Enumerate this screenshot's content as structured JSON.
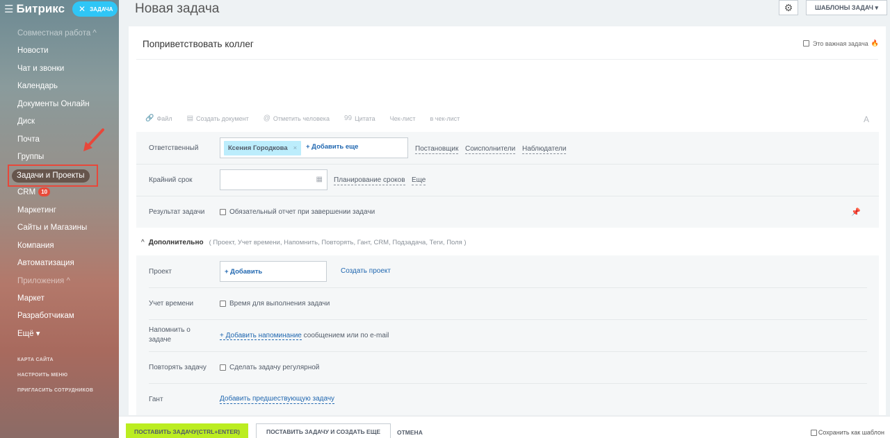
{
  "sidebar": {
    "logo": "Битрикс",
    "task_pill": "ЗАДАЧА",
    "section_collab": "Совместная работа ^",
    "items": [
      "Новости",
      "Чат и звонки",
      "Календарь",
      "Документы Онлайн",
      "Диск",
      "Почта",
      "Группы"
    ],
    "active_item": "Задачи и Проекты",
    "crm_label": "CRM",
    "crm_badge": "10",
    "items2": [
      "Маркетинг",
      "Сайты и Магазины",
      "Компания",
      "Автоматизация"
    ],
    "section_apps": "Приложения ^",
    "items3": [
      "Маркет",
      "Разработчикам",
      "Ещё ▾"
    ],
    "footer_links": [
      "КАРТА САЙТА",
      "НАСТРОИТЬ МЕНЮ",
      "ПРИГЛАСИТЬ СОТРУДНИКОВ"
    ]
  },
  "header": {
    "title": "Новая задача",
    "templates_button": "ШАБЛОНЫ ЗАДАЧ ▾"
  },
  "form": {
    "task_title": "Поприветствовать коллег",
    "important_label": "Это важная задача",
    "toolbar": [
      "Файл",
      "Создать документ",
      "Отметить человека",
      "Цитата",
      "Чек-лист",
      "в чек-лист"
    ],
    "font_icon": "A",
    "responsible": {
      "label": "Ответственный",
      "chip": "Ксения Городкова",
      "add_more": "+ Добавить еще",
      "links": [
        "Постановщик",
        "Соисполнители",
        "Наблюдатели"
      ]
    },
    "deadline": {
      "label": "Крайний срок",
      "link_planning": "Планирование сроков",
      "link_more": "Еще"
    },
    "result": {
      "label": "Результат задачи",
      "checkbox": "Обязательный отчет при завершении задачи"
    },
    "additional": {
      "heading": "Дополнительно",
      "list": "( Проект,  Учет времени,  Напомнить,  Повторять,  Гант,  CRM,  Подзадача,  Теги,  Поля )"
    },
    "project": {
      "label": "Проект",
      "add": "+ Добавить",
      "create": "Создать проект"
    },
    "time": {
      "label": "Учет времени",
      "checkbox": "Время для выполнения задачи"
    },
    "remind": {
      "label_line1": "Напомнить о",
      "label_line2": "задаче",
      "link": "+ Добавить напоминание",
      "suffix": " сообщением или по e-mail"
    },
    "repeat": {
      "label": "Повторять задачу",
      "checkbox": "Сделать задачу регулярной"
    },
    "gantt": {
      "label": "Гант",
      "link": "Добавить предшествующую задачу"
    }
  },
  "footer": {
    "submit": "ПОСТАВИТЬ ЗАДАЧУ(CTRL+ENTER)",
    "submit_more": "ПОСТАВИТЬ ЗАДАЧУ И СОЗДАТЬ ЕЩЕ",
    "cancel": "ОТМЕНА",
    "save_template": "Сохранить как шаблон"
  }
}
